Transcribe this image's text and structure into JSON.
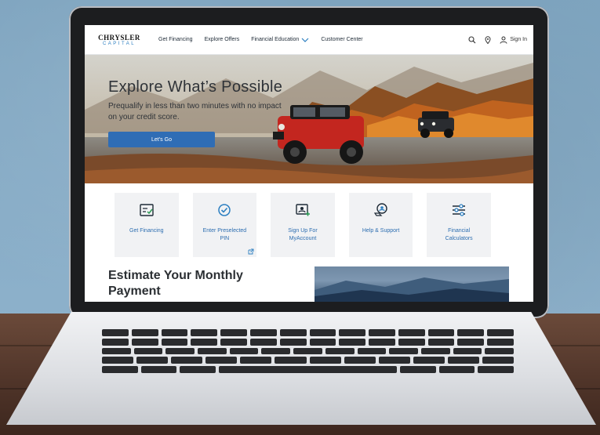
{
  "nav": {
    "logo_top": "CHRYSLER",
    "logo_bottom": "CAPITAL",
    "links": [
      "Get Financing",
      "Explore Offers",
      "Financial Education",
      "Customer Center"
    ],
    "sign_in": "Sign In"
  },
  "hero": {
    "title": "Explore What’s Possible",
    "subtitle": "Prequalify in less than two minutes with no impact on your credit score.",
    "cta": "Let’s Go"
  },
  "tiles": [
    {
      "label": "Get Financing",
      "icon": "checklist-icon"
    },
    {
      "label": "Enter Preselected PIN",
      "icon": "check-badge-icon"
    },
    {
      "label": "Sign Up For MyAccount",
      "icon": "account-add-icon"
    },
    {
      "label": "Help & Support",
      "icon": "support-icon"
    },
    {
      "label": "Financial Calculators",
      "icon": "sliders-icon"
    }
  ],
  "estimate": {
    "title": "Estimate Your Monthly Payment"
  },
  "colors": {
    "accent": "#2f6db5",
    "tile_bg": "#f1f2f4",
    "link": "#2c6db0"
  }
}
